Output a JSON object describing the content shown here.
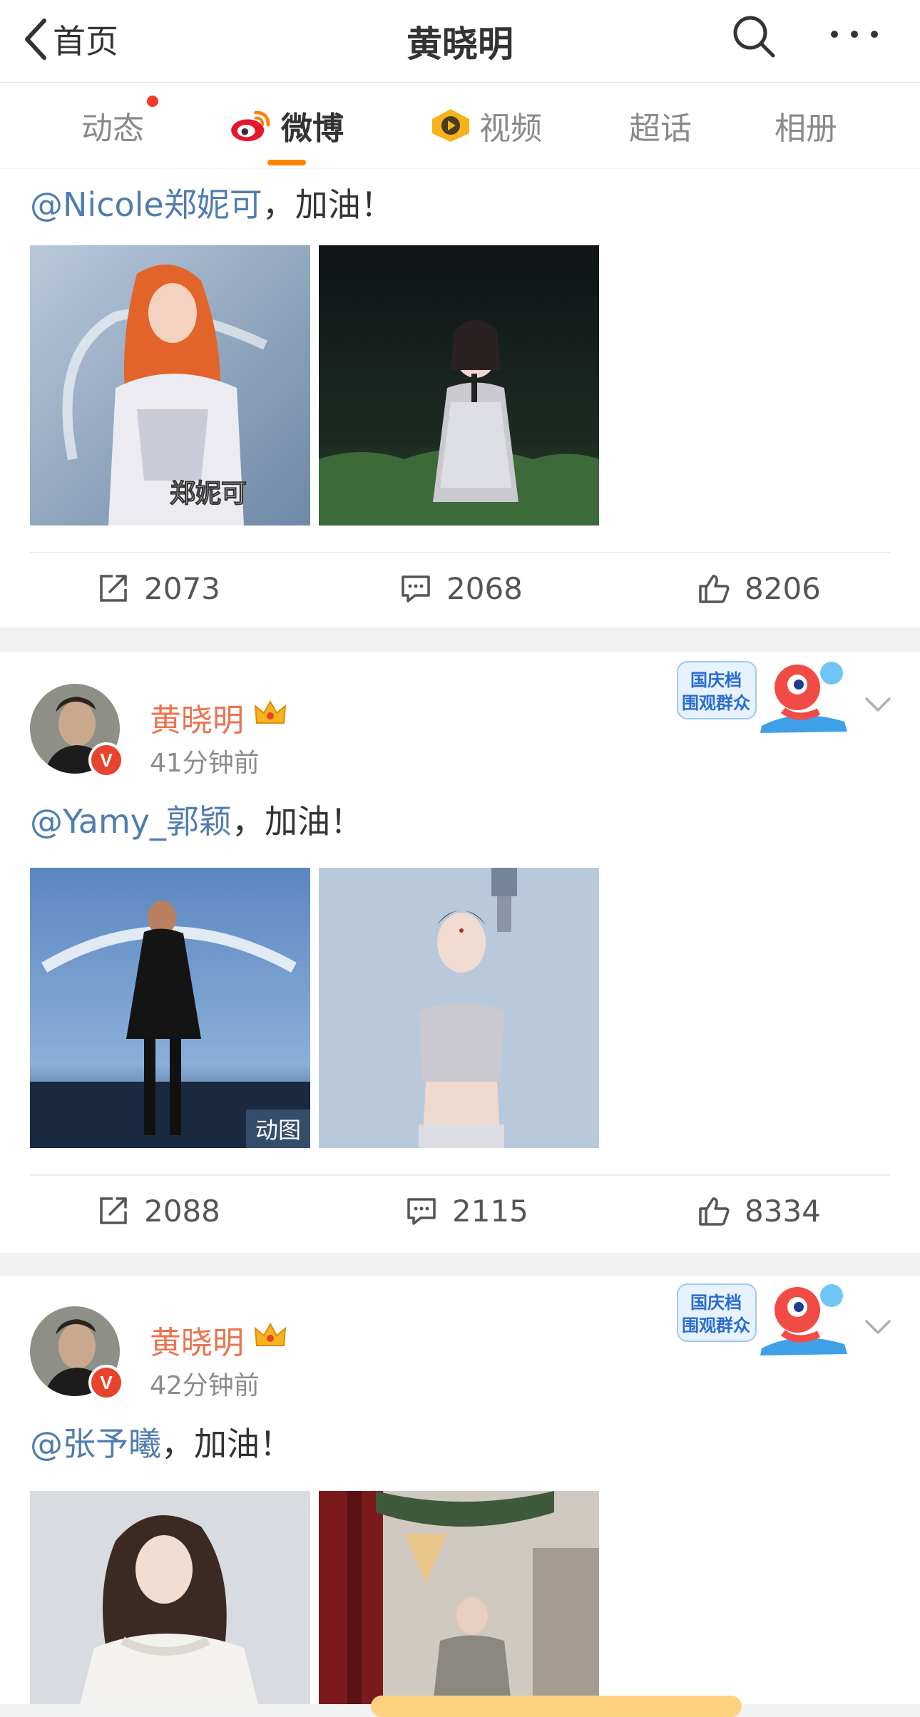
{
  "header": {
    "back_label": "首页",
    "title": "黄晓明"
  },
  "tabs": [
    {
      "label": "动态",
      "has_dot": true
    },
    {
      "label": "微博",
      "active": true
    },
    {
      "label": "视频"
    },
    {
      "label": "超话"
    },
    {
      "label": "相册"
    }
  ],
  "posts": [
    {
      "mention": "@Nicole郑妮可",
      "suffix": "，加油！",
      "images": [
        {
          "overlay_text": "郑妮可"
        },
        {
          "overlay_text": ""
        }
      ],
      "actions": {
        "repost": "2073",
        "comment": "2068",
        "like": "8206"
      }
    },
    {
      "author": "黄晓明",
      "time": "41分钟前",
      "mention": "@Yamy_郭颖",
      "suffix": "，加油！",
      "sticker_text": [
        "国庆档",
        "围观群众"
      ],
      "images": [
        {
          "badge": "动图"
        },
        {
          "badge": ""
        }
      ],
      "actions": {
        "repost": "2088",
        "comment": "2115",
        "like": "8334"
      }
    },
    {
      "author": "黄晓明",
      "time": "42分钟前",
      "mention": "@张予曦",
      "suffix": "，加油！",
      "sticker_text": [
        "国庆档",
        "围观群众"
      ]
    }
  ],
  "colors": {
    "accent": "#ff8200",
    "mention": "#507daf",
    "username": "#eb7350",
    "verified": "#e8432c"
  },
  "icons": [
    "back-chevron-icon",
    "search-icon",
    "more-icon",
    "weibo-logo-icon",
    "video-icon",
    "repost-icon",
    "comment-icon",
    "like-icon",
    "crown-icon",
    "verified-badge-icon",
    "chevron-down-icon"
  ]
}
